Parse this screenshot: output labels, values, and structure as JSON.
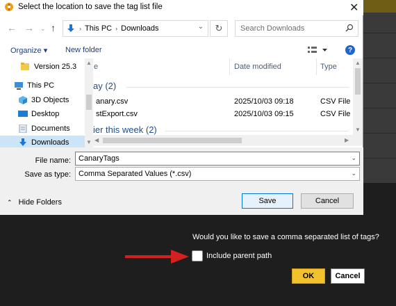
{
  "dialog": {
    "title": "Select the location to save the tag list file",
    "close_glyph": "✕",
    "nav": {
      "back": "←",
      "forward": "→",
      "up": "↑",
      "refresh": "↻"
    },
    "address": {
      "parts": [
        "This PC",
        "Downloads"
      ]
    },
    "search": {
      "placeholder": "Search Downloads"
    },
    "toolbar": {
      "organize": "Organize ▾",
      "new_folder": "New folder",
      "help": "?"
    },
    "nav_pane": {
      "items": [
        {
          "label": "Version 25.3",
          "icon": "folder-icon"
        },
        {
          "label": "This PC",
          "icon": "computer-icon"
        },
        {
          "label": "3D Objects",
          "icon": "3d-objects-icon"
        },
        {
          "label": "Desktop",
          "icon": "desktop-icon"
        },
        {
          "label": "Documents",
          "icon": "documents-icon"
        },
        {
          "label": "Downloads",
          "icon": "downloads-icon",
          "selected": true
        }
      ]
    },
    "file_list": {
      "columns": [
        "e",
        "Date modified",
        "Type"
      ],
      "groups": [
        {
          "label": "ay (2)"
        },
        {
          "label": "ier this week (2)"
        }
      ],
      "rows": [
        {
          "name": "anary.csv",
          "date": "2025/10/03 09:18",
          "type": "CSV File"
        },
        {
          "name": "stExport.csv",
          "date": "2025/10/03 09:15",
          "type": "CSV File"
        }
      ]
    },
    "filename_label": "File name:",
    "filename_value": "CanaryTags",
    "type_label": "Save as type:",
    "type_value": "Comma Separated Values  (*.csv)",
    "hide_folders": "Hide Folders",
    "save_label": "Save",
    "cancel_label": "Cancel"
  },
  "app_prompt": {
    "question": "Would you like to save a comma separated list of tags?",
    "checkbox_label": "Include parent path",
    "checkbox_checked": false,
    "ok_label": "OK",
    "cancel_label": "Cancel"
  },
  "colors": {
    "accent": "#f2c12e",
    "arrow": "#d42020",
    "link": "#1e4e8c",
    "selection": "#cce4f7"
  }
}
